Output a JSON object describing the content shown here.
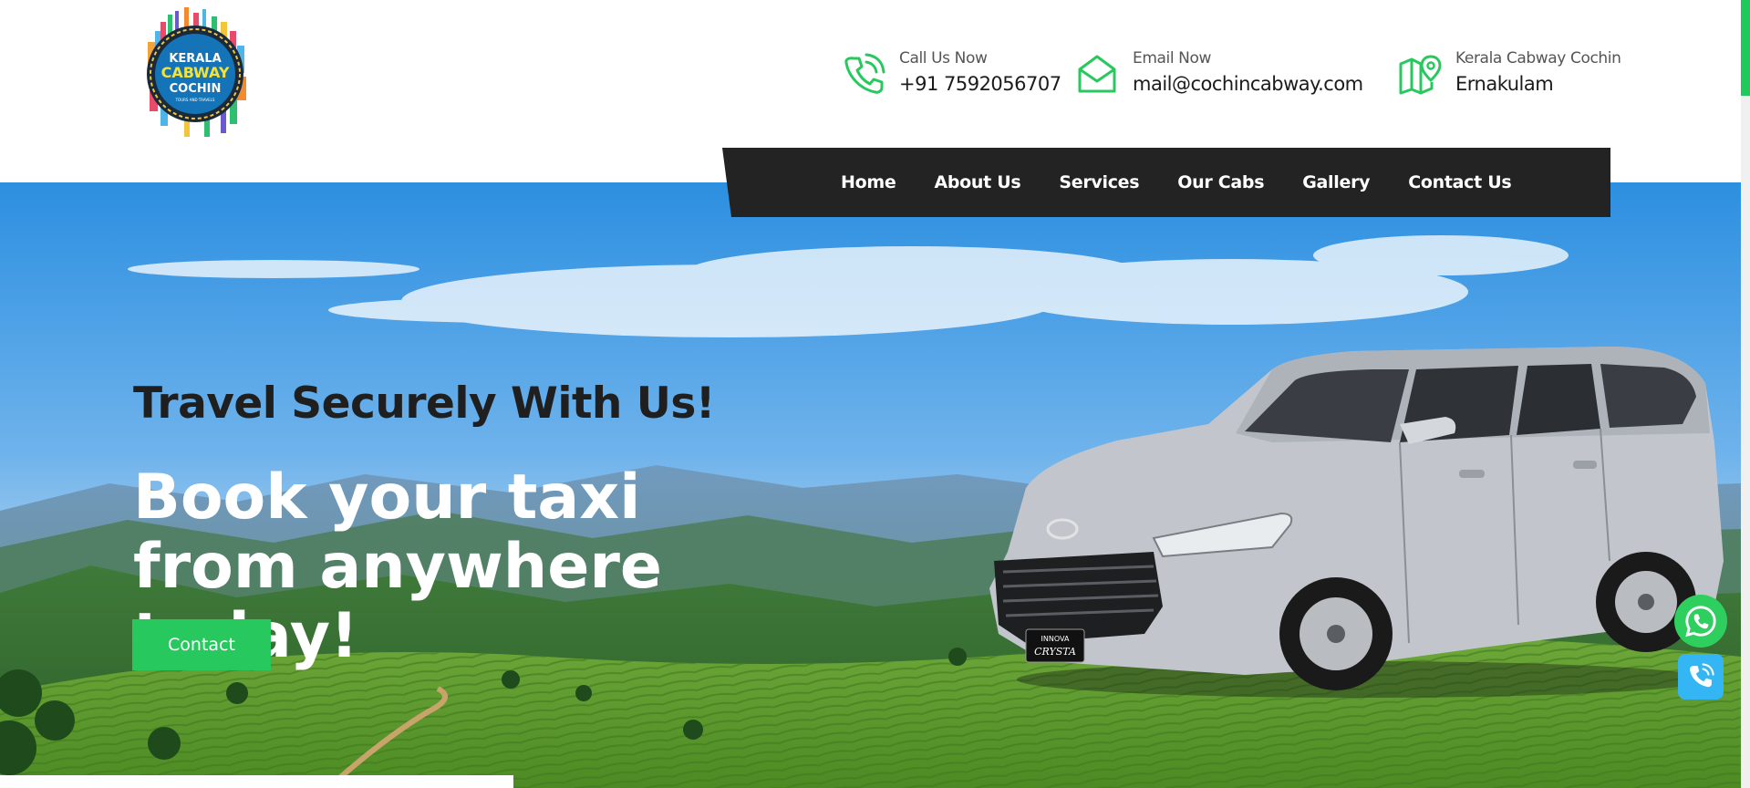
{
  "logo": {
    "line1": "KERALA",
    "line2": "CABWAY",
    "line3": "COCHIN",
    "line4": "TOURS AND TRAVELS"
  },
  "header_contacts": [
    {
      "label": "Call Us Now",
      "value": "+91 7592056707",
      "icon": "phone-icon"
    },
    {
      "label": "Email Now",
      "value": "mail@cochincabway.com",
      "icon": "mail-icon"
    },
    {
      "label": "Kerala Cabway Cochin",
      "value": "Ernakulam",
      "icon": "map-icon"
    }
  ],
  "nav": [
    "Home",
    "About Us",
    "Services",
    "Our Cabs",
    "Gallery",
    "Contact Us"
  ],
  "hero": {
    "tagline": "Travel Securely With Us!",
    "headline": "Book your taxi from anywhere today!",
    "button_label": "Contact"
  },
  "car_badge": {
    "line1": "INNOVA",
    "line2": "CRYSTA"
  },
  "colors": {
    "accent": "#27c95e",
    "nav_bg": "#232323",
    "whatsapp": "#2fcf5f",
    "phone": "#35b6f4"
  }
}
